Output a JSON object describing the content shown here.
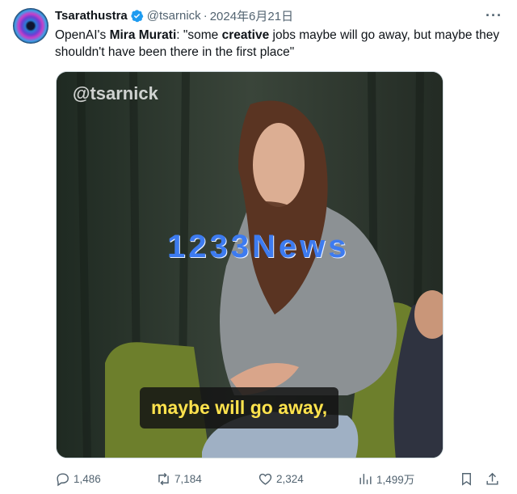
{
  "author": {
    "display_name": "Tsarathustra",
    "handle": "@tsarnick",
    "separator": "·",
    "date": "2024年6月21日"
  },
  "tweet": {
    "prefix": "OpenAI's ",
    "name": "Mira Murati",
    "mid": ": \"some ",
    "emph": "creative",
    "rest": " jobs maybe will go away, but maybe they shouldn't have been there in the first place\""
  },
  "media": {
    "watermark_handle": "@tsarnick",
    "watermark_news": "1233News",
    "caption": "maybe will go away,"
  },
  "actions": {
    "replies": "1,486",
    "reposts": "7,184",
    "likes": "2,324",
    "views": "1,499万"
  },
  "colors": {
    "text": "#0f1419",
    "secondary": "#536471",
    "verified": "#1d9bf0",
    "caption_text": "#ffe34d",
    "watermark_news": "#3d7bf0"
  },
  "icons": [
    "more-icon",
    "verified-badge-icon",
    "reply-icon",
    "repost-icon",
    "like-icon",
    "views-icon",
    "bookmark-icon",
    "share-icon"
  ]
}
